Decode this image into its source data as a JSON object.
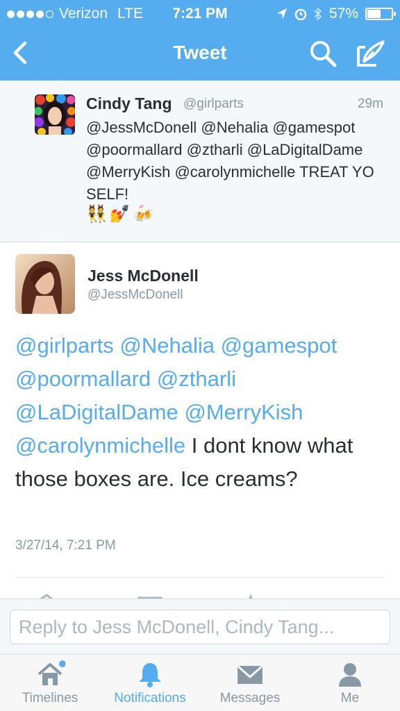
{
  "status_bar": {
    "carrier": "Verizon",
    "network": "LTE",
    "time": "7:21 PM",
    "battery_percent": "57%",
    "battery_level": 0.57
  },
  "nav": {
    "title": "Tweet"
  },
  "parent_tweet": {
    "name": "Cindy Tang",
    "handle": "@girlparts",
    "time": "29m",
    "text": "@JessMcDonell @Nehalia @gamespot @poormallard @ztharli @LaDigitalDame @MerryKish @carolynmichelle TREAT YO SELF!",
    "emojis": [
      "👯",
      "💅",
      "🍻"
    ]
  },
  "main_tweet": {
    "name": "Jess McDonell",
    "handle": "@JessMcDonell",
    "mentions": [
      "@girlparts",
      "@Nehalia",
      "@gamespot",
      "@poormallard",
      "@ztharli",
      "@LaDigitalDame",
      "@MerryKish",
      "@carolynmichelle"
    ],
    "body": "I dont know what those boxes are. Ice creams?",
    "timestamp": "3/27/14, 7:21 PM"
  },
  "reply": {
    "placeholder": "Reply to Jess McDonell, Cindy Tang..."
  },
  "tabs": [
    {
      "label": "Timelines",
      "icon": "home-icon",
      "active": false,
      "badge": true
    },
    {
      "label": "Notifications",
      "icon": "bell-icon",
      "active": true
    },
    {
      "label": "Messages",
      "icon": "envelope-icon",
      "active": false
    },
    {
      "label": "Me",
      "icon": "person-icon",
      "active": false
    }
  ],
  "colors": {
    "brand_blue": "#55acee",
    "text_dark": "#292f33",
    "text_gray": "#8899a6"
  }
}
